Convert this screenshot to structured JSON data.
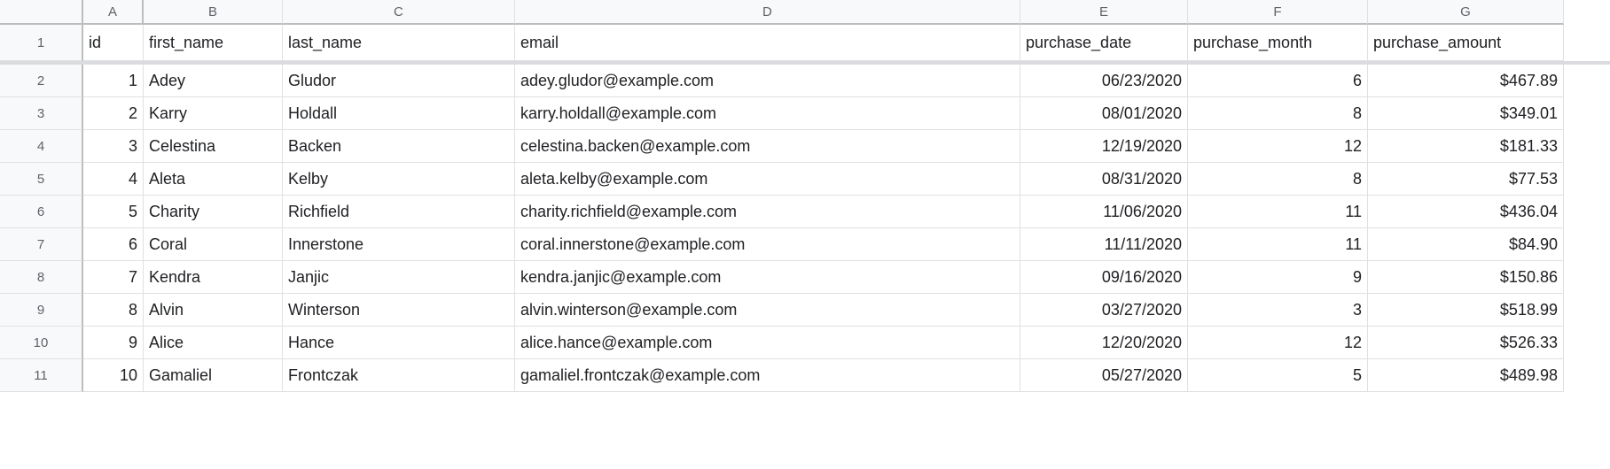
{
  "columns": [
    "A",
    "B",
    "C",
    "D",
    "E",
    "F",
    "G"
  ],
  "row_numbers": [
    "1",
    "2",
    "3",
    "4",
    "5",
    "6",
    "7",
    "8",
    "9",
    "10",
    "11"
  ],
  "headers": {
    "A": "id",
    "B": "first_name",
    "C": "last_name",
    "D": "email",
    "E": "purchase_date",
    "F": "purchase_month",
    "G": "purchase_amount"
  },
  "rows": [
    {
      "A": "1",
      "B": "Adey",
      "C": "Gludor",
      "D": "adey.gludor@example.com",
      "E": "06/23/2020",
      "F": "6",
      "G": "$467.89"
    },
    {
      "A": "2",
      "B": "Karry",
      "C": "Holdall",
      "D": "karry.holdall@example.com",
      "E": "08/01/2020",
      "F": "8",
      "G": "$349.01"
    },
    {
      "A": "3",
      "B": "Celestina",
      "C": "Backen",
      "D": "celestina.backen@example.com",
      "E": "12/19/2020",
      "F": "12",
      "G": "$181.33"
    },
    {
      "A": "4",
      "B": "Aleta",
      "C": "Kelby",
      "D": "aleta.kelby@example.com",
      "E": "08/31/2020",
      "F": "8",
      "G": "$77.53"
    },
    {
      "A": "5",
      "B": "Charity",
      "C": "Richfield",
      "D": "charity.richfield@example.com",
      "E": "11/06/2020",
      "F": "11",
      "G": "$436.04"
    },
    {
      "A": "6",
      "B": "Coral",
      "C": "Innerstone",
      "D": "coral.innerstone@example.com",
      "E": "11/11/2020",
      "F": "11",
      "G": "$84.90"
    },
    {
      "A": "7",
      "B": "Kendra",
      "C": "Janjic",
      "D": "kendra.janjic@example.com",
      "E": "09/16/2020",
      "F": "9",
      "G": "$150.86"
    },
    {
      "A": "8",
      "B": "Alvin",
      "C": "Winterson",
      "D": "alvin.winterson@example.com",
      "E": "03/27/2020",
      "F": "3",
      "G": "$518.99"
    },
    {
      "A": "9",
      "B": "Alice",
      "C": "Hance",
      "D": "alice.hance@example.com",
      "E": "12/20/2020",
      "F": "12",
      "G": "$526.33"
    },
    {
      "A": "10",
      "B": "Gamaliel",
      "C": "Frontczak",
      "D": "gamaliel.frontczak@example.com",
      "E": "05/27/2020",
      "F": "5",
      "G": "$489.98"
    }
  ]
}
